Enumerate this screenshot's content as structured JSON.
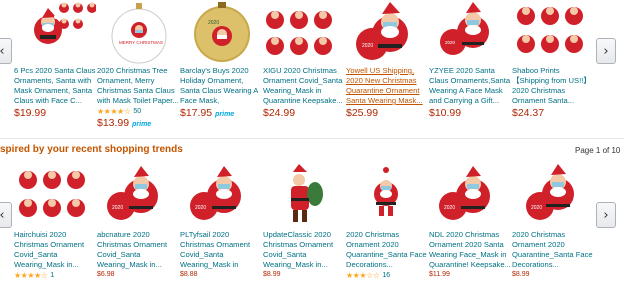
{
  "row1": {
    "items": [
      {
        "title": "6 Pcs 2020 Santa Claus Ornaments, Santa with Mask Ornament, Santa Claus with Face C...",
        "price": "$19.99"
      },
      {
        "title": "2020 Christmas Tree Ornament, Merry Christmas Santa Claus with Mask Toilet Paper...",
        "ornament_text": "MERRY CHRISTMAS",
        "stars": "★★★★☆",
        "reviews": "50",
        "price": "$13.99",
        "badge": "prime"
      },
      {
        "title": "Barclay's Buys 2020 Holiday Ornament, Santa Claus Wearing A Face Mask, Quarantine...",
        "price": "$17.95",
        "badge": "prime"
      },
      {
        "title": "XIGU 2020 Christmas Ornament Covid_Santa Wearing_Mask in Quarantine Keepsake...",
        "price": "$24.99"
      },
      {
        "title": "Yowell US Shipping, 2020 New Christmas Quarantine Ornament Santa Wearing Mask...",
        "price": "$25.99"
      },
      {
        "title": "YZYEE 2020 Santa Claus Ornaments,Santa Wearing A Face Mask and Carrying a Gift...",
        "price": "$10.99"
      },
      {
        "title": "Shaboo Prints 【Shipping from US!!】 2020 Christmas Ornament Santa...",
        "price": "$24.37"
      }
    ]
  },
  "section": {
    "title": "spired by your recent shopping trends",
    "page": "Page 1 of 10"
  },
  "row2": {
    "items": [
      {
        "title": "Hairchuisi 2020 Christmas Ornament Covid_Santa Wearing_Mask in...",
        "stars": "★★★★☆",
        "reviews": "1"
      },
      {
        "title": "abcnature 2020 Christmas Ornament Covid_Santa Wearing_Mask in...",
        "price": "$6.98"
      },
      {
        "title": "PLTyfsail 2020 Christmas Ornament Covid_Santa Wearing_Mask in Quarantine Keepsake...",
        "price": "$8.88"
      },
      {
        "title": "UpdateClassic 2020 Christmas Ornament Covid_Santa Wearing_Mask in...",
        "price": "$8.99"
      },
      {
        "title": "2020 Christmas Ornament 2020 Quarantine_Santa Face Decorations...",
        "stars": "★★★☆☆",
        "reviews": "16"
      },
      {
        "title": "NDL 2020 Christmas Ornament 2020 Santa Wearing Face_Mask in Quarantine! Keepsake...",
        "price": "$11.99"
      },
      {
        "title": "2020 Christmas Ornament 2020 Quarantine_Santa Face Decorations...",
        "price": "$8.99"
      }
    ]
  },
  "nav": {
    "prev": "‹",
    "next": "›"
  },
  "colors": {
    "link": "#007185",
    "price": "#b12704",
    "accent": "#c45500",
    "star": "#ffa41c"
  }
}
